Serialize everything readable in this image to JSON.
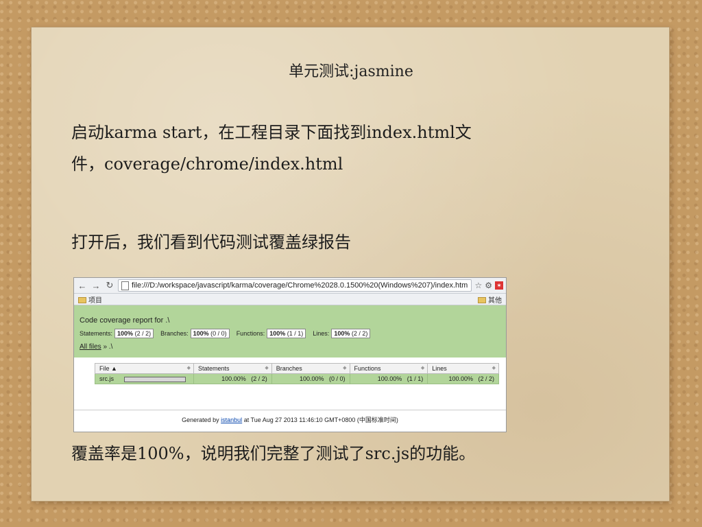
{
  "slide": {
    "title": "单元测试:jasmine",
    "para1_line1": "启动karma start，在工程目录下面找到index.html文",
    "para1_line2": "件，coverage/chrome/index.html",
    "para2": "打开后，我们看到代码测试覆盖绿报告",
    "para3": "覆盖率是100%，说明我们完整了测试了src.js的功能。"
  },
  "browser": {
    "back_icon": "←",
    "forward_icon": "→",
    "reload_icon": "↻",
    "url": "file:///D:/workspace/javascript/karma/coverage/Chrome%2028.0.1500%20(Windows%207)/index.htm",
    "star_icon": "☆",
    "gear_icon": "⚙",
    "ext_icon": "✶",
    "bookmark_left": "项目",
    "bookmark_right": "其他"
  },
  "report": {
    "title": "Code coverage report for .\\",
    "statements_label": "Statements:",
    "statements_pct": "100%",
    "statements_frac": "(2 / 2)",
    "branches_label": "Branches:",
    "branches_pct": "100%",
    "branches_frac": "(0 / 0)",
    "functions_label": "Functions:",
    "functions_pct": "100%",
    "functions_frac": "(1 / 1)",
    "lines_label": "Lines:",
    "lines_pct": "100%",
    "lines_frac": "(2 / 2)",
    "all_files": "All files",
    "crumb_rest": "» .\\",
    "columns": [
      "File ▲",
      "Statements",
      "Branches",
      "Functions",
      "Lines"
    ],
    "sort_icon": "◆",
    "row": {
      "file": "src.js",
      "statements_pct": "100.00%",
      "statements_frac": "(2 / 2)",
      "branches_pct": "100.00%",
      "branches_frac": "(0 / 0)",
      "functions_pct": "100.00%",
      "functions_frac": "(1 / 1)",
      "lines_pct": "100.00%",
      "lines_frac": "(2 / 2)"
    },
    "footer_prefix": "Generated by",
    "footer_link": "istanbul",
    "footer_suffix": "at Tue Aug 27 2013 11:46:10 GMT+0800 (中国标准时间)"
  }
}
